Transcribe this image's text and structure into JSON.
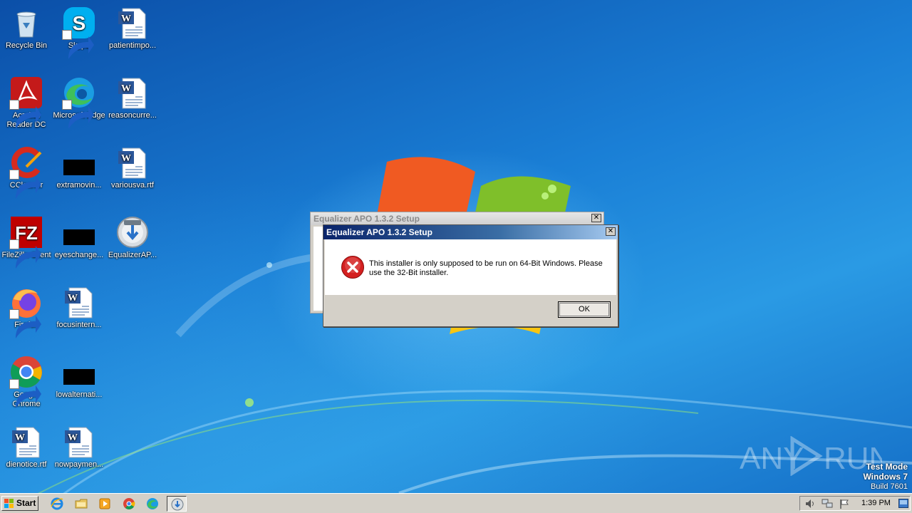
{
  "desktop": {
    "icons": [
      {
        "label": "Recycle Bin",
        "icon": "recycle-bin-icon"
      },
      {
        "label": "Skype",
        "icon": "skype-icon"
      },
      {
        "label": "patientimpo...",
        "icon": "word-document-icon"
      },
      {
        "label": "Acrobat Reader DC",
        "icon": "acrobat-reader-icon"
      },
      {
        "label": "Microsoft Edge",
        "icon": "edge-icon"
      },
      {
        "label": "reasoncurre...",
        "icon": "word-document-icon"
      },
      {
        "label": "CCleaner",
        "icon": "ccleaner-icon"
      },
      {
        "label": "extramovin...",
        "icon": "black-file-icon"
      },
      {
        "label": "variousva.rtf",
        "icon": "word-document-icon"
      },
      {
        "label": "FileZilla Client",
        "icon": "filezilla-icon"
      },
      {
        "label": "eyeschange...",
        "icon": "black-file-icon"
      },
      {
        "label": "EqualizerAP...",
        "icon": "installer-icon"
      },
      {
        "label": "Firefox",
        "icon": "firefox-icon"
      },
      {
        "label": "focusintern...",
        "icon": "word-document-icon"
      },
      {
        "label": "Google Chrome",
        "icon": "chrome-icon"
      },
      {
        "label": "lowalternati...",
        "icon": "black-file-icon"
      },
      {
        "label": "dienotice.rtf",
        "icon": "word-document-icon"
      },
      {
        "label": "nowpaymen...",
        "icon": "word-document-icon"
      }
    ]
  },
  "background_dialog": {
    "title": "Equalizer APO 1.3.2 Setup",
    "close_label": "✕"
  },
  "error_dialog": {
    "title": "Equalizer APO 1.3.2 Setup",
    "close_label": "✕",
    "message": "This installer is only supposed to be run on 64-Bit Windows. Please use the 32-Bit installer.",
    "ok_label": "OK",
    "icon": "error-icon"
  },
  "watermark": {
    "brand": "ANY RUN",
    "test_mode": "Test Mode",
    "os": "Windows 7",
    "build": "Build 7601"
  },
  "taskbar": {
    "start_label": "Start",
    "pinned": [
      "internet-explorer-icon",
      "file-explorer-icon",
      "media-player-icon",
      "chrome-icon",
      "edge-icon",
      "installer-icon"
    ],
    "clock": "1:39 PM",
    "tray_icons": [
      "volume-icon",
      "network-icon",
      "action-center-flag-icon"
    ]
  },
  "colors": {
    "desktop_blue": "#1a7fd6",
    "titlebar_active": "#0a246a",
    "dialog_face": "#d4d0c8",
    "error_red": "#d42020"
  }
}
